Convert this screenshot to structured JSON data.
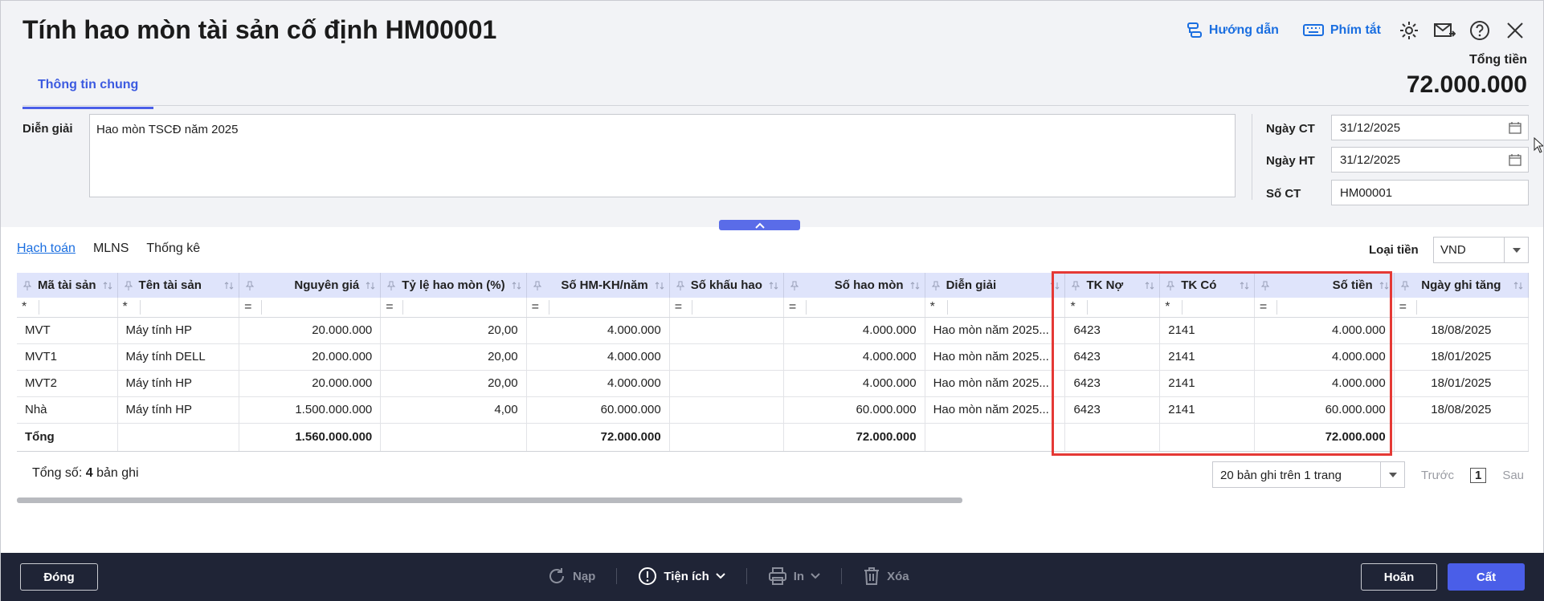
{
  "header": {
    "title": "Tính hao mòn tài sản cố định HM00001",
    "help_label": "Hướng dẫn",
    "shortcut_label": "Phím tắt",
    "total_label": "Tổng tiền",
    "total_value": "72.000.000"
  },
  "tabs": {
    "general": "Thông tin chung"
  },
  "form": {
    "description_label": "Diễn giải",
    "description_value": "Hao mòn TSCĐ năm 2025",
    "voucher_date_label": "Ngày CT",
    "voucher_date_value": "31/12/2025",
    "posting_date_label": "Ngày HT",
    "posting_date_value": "31/12/2025",
    "voucher_no_label": "Số CT",
    "voucher_no_value": "HM00001"
  },
  "subtabs": [
    "Hạch toán",
    "MLNS",
    "Thống kê"
  ],
  "currency": {
    "label": "Loại tiền",
    "value": "VND"
  },
  "grid": {
    "columns": [
      "Mã tài sản",
      "Tên tài sản",
      "Nguyên giá",
      "Tỷ lệ hao mòn (%)",
      "Số HM-KH/năm",
      "Số khấu hao",
      "Số hao mòn",
      "Diễn giải",
      "TK Nợ",
      "TK Có",
      "Số tiền",
      "Ngày ghi tăng"
    ],
    "filter": [
      "*",
      "*",
      "=",
      "=",
      "=",
      "=",
      "=",
      "*",
      "*",
      "*",
      "=",
      "="
    ],
    "rows": [
      [
        "MVT",
        "Máy tính HP",
        "20.000.000",
        "20,00",
        "4.000.000",
        "",
        "4.000.000",
        "Hao mòn năm 2025...",
        "6423",
        "2141",
        "4.000.000",
        "18/08/2025"
      ],
      [
        "MVT1",
        "Máy tính DELL",
        "20.000.000",
        "20,00",
        "4.000.000",
        "",
        "4.000.000",
        "Hao mòn năm 2025...",
        "6423",
        "2141",
        "4.000.000",
        "18/01/2025"
      ],
      [
        "MVT2",
        "Máy tính HP",
        "20.000.000",
        "20,00",
        "4.000.000",
        "",
        "4.000.000",
        "Hao mòn năm 2025...",
        "6423",
        "2141",
        "4.000.000",
        "18/01/2025"
      ],
      [
        "Nhà",
        "Máy tính HP",
        "1.500.000.000",
        "4,00",
        "60.000.000",
        "",
        "60.000.000",
        "Hao mòn năm 2025...",
        "6423",
        "2141",
        "60.000.000",
        "18/08/2025"
      ]
    ],
    "total": [
      "Tổng",
      "",
      "1.560.000.000",
      "",
      "72.000.000",
      "",
      "72.000.000",
      "",
      "",
      "",
      "72.000.000",
      ""
    ]
  },
  "footer": {
    "count_prefix": "Tổng số:",
    "count_value": "4",
    "count_suffix": "bản ghi",
    "page_size": "20 bản ghi trên 1 trang",
    "prev": "Trước",
    "page": "1",
    "next": "Sau"
  },
  "bottombar": {
    "close": "Đóng",
    "reload": "Nạp",
    "utilities": "Tiện ích",
    "print": "In",
    "delete": "Xóa",
    "cancel": "Hoãn",
    "save": "Cất"
  },
  "colors": {
    "accent": "#4a5ee8",
    "link": "#1a6ee0",
    "highlight": "#e53935",
    "bar": "#1f2436"
  }
}
